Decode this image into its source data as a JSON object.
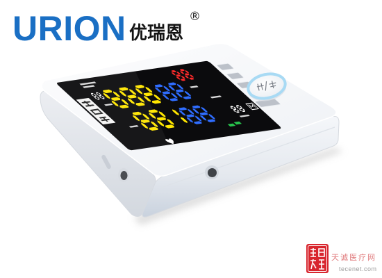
{
  "brand": {
    "logo_text": "URION",
    "name_cn": "优瑞恩",
    "registered_mark": "®",
    "logo_color": "#1a6fc4"
  },
  "device": {
    "display_colors": {
      "primary_digits": "#ffe600",
      "secondary_digits": "#2f6dff",
      "memory_digits": "#ff2b2b",
      "indicator": "#27c24c",
      "labels": "#ffffff"
    },
    "ring_color": "#a8daf4"
  },
  "watermark": {
    "site_name": "天诚医疗网",
    "site_url": "tecenet.com",
    "seal_color": "#d8262e"
  }
}
